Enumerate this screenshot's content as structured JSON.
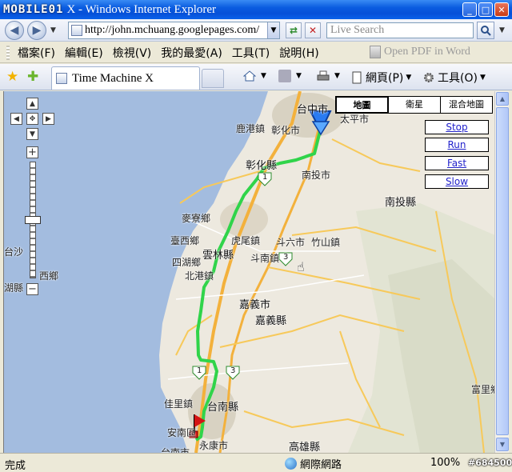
{
  "window": {
    "brand": "MOBILE01",
    "title": "X - Windows Internet Explorer"
  },
  "address": {
    "url": "http://john.mchuang.googlepages.com/",
    "search_placeholder": "Live Search"
  },
  "menu": {
    "items": [
      "檔案(F)",
      "編輯(E)",
      "檢視(V)",
      "我的最愛(A)",
      "工具(T)",
      "說明(H)"
    ],
    "pdf": "Open PDF in Word"
  },
  "tab": {
    "label": "Time Machine X"
  },
  "commands": {
    "page": "網頁(P)",
    "tools": "工具(O)"
  },
  "map": {
    "types": [
      "地圖",
      "衛星",
      "混合地圖"
    ],
    "controls": [
      "Stop",
      "Run",
      "Fast",
      "Slow"
    ],
    "zoom_in": "+",
    "zoom_out": "−",
    "places": {
      "taichung": "台中市",
      "taiping": "太平市",
      "lugang": "鹿港鎮",
      "changhua_city": "彰化市",
      "changhua_county": "彰化縣",
      "nantou_city": "南投市",
      "nantou_county": "南投縣",
      "maiiao": "麥寮鄉",
      "taixi": "臺西鄉",
      "huwei": "虎尾鎮",
      "douliu": "斗六市",
      "zhushan": "竹山鎮",
      "sihu": "四湖鄉",
      "yunlin": "雲林縣",
      "dounan": "斗南鎮",
      "beigang": "北港鎮",
      "chiayi_city": "嘉義市",
      "chiayi_county": "嘉義縣",
      "taisha": "台沙",
      "xi": "西鄉",
      "hu": "湖縣",
      "jiali": "佳里鎮",
      "tainan_county": "台南縣",
      "annan": "安南區",
      "yongkang": "永康市",
      "tainan": "台南市",
      "kaohsiung": "高雄縣",
      "fuli": "富里鄉",
      "shield_1a": "1",
      "shield_3a": "3",
      "shield_1b": "1",
      "shield_3b": "3"
    }
  },
  "status": {
    "text": "完成",
    "zone": "網際網路",
    "zoom": "100%",
    "watermark": "#684500"
  }
}
